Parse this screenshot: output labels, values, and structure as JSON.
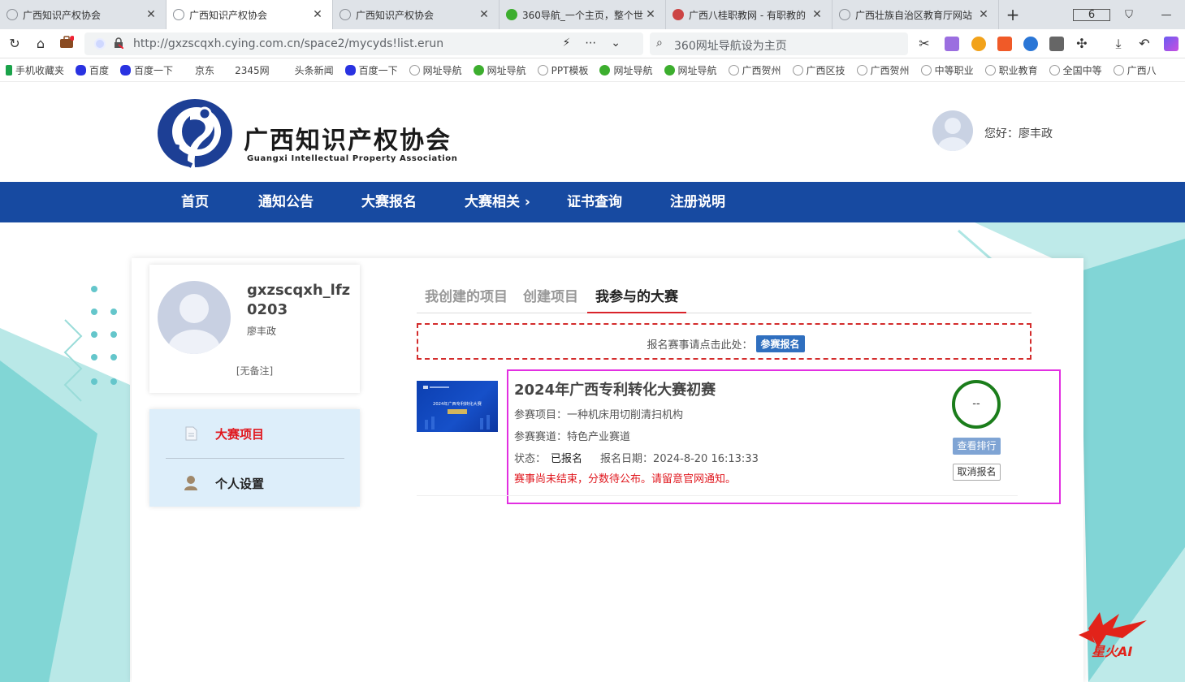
{
  "browser": {
    "tabs": [
      {
        "label": "广西知识产权协会",
        "close": "✕",
        "icon": "globe-icon"
      },
      {
        "label": "广西知识产权协会",
        "close": "✕",
        "icon": "globe-icon"
      },
      {
        "label": "广西知识产权协会",
        "close": "✕",
        "icon": "globe-icon"
      },
      {
        "label": "360导航_一个主页，整个世",
        "close": "✕",
        "icon": "360-icon"
      },
      {
        "label": "广西八桂职教网 - 有职教的",
        "close": "✕",
        "icon": "emblem-icon"
      },
      {
        "label": "广西壮族自治区教育厅网站",
        "close": "✕",
        "icon": "globe-icon"
      }
    ],
    "new_tab": "+",
    "tab_count": "6",
    "url": "http://gxzscqxh.cying.com.cn/space2/mycyds!list.erun",
    "search_placeholder": "360网址导航设为主页",
    "bookmarks": [
      {
        "label": "手机收藏夹",
        "icon": "phone-icon"
      },
      {
        "label": "百度",
        "icon": "baidu-icon"
      },
      {
        "label": "百度一下",
        "icon": "baidu-icon"
      },
      {
        "label": "京东",
        "icon": "none"
      },
      {
        "label": "2345网",
        "icon": "none"
      },
      {
        "label": "头条新闻",
        "icon": "none"
      },
      {
        "label": "百度一下",
        "icon": "baidu-icon"
      },
      {
        "label": "网址导航",
        "icon": "globe-icon"
      },
      {
        "label": "网址导航",
        "icon": "360-icon"
      },
      {
        "label": "PPT模板",
        "icon": "globe-icon"
      },
      {
        "label": "网址导航",
        "icon": "360-icon"
      },
      {
        "label": "网址导航",
        "icon": "360-icon"
      },
      {
        "label": "广西贺州",
        "icon": "globe-icon"
      },
      {
        "label": "广西区技",
        "icon": "globe-icon"
      },
      {
        "label": "广西贺州",
        "icon": "globe-icon"
      },
      {
        "label": "中等职业",
        "icon": "globe-icon"
      },
      {
        "label": "职业教育",
        "icon": "globe-icon"
      },
      {
        "label": "全国中等",
        "icon": "globe-icon"
      },
      {
        "label": "广西八",
        "icon": "globe-icon"
      }
    ]
  },
  "site": {
    "logo_cn": "广西知识产权协会",
    "logo_en": "Guangxi Intellectual Property Association",
    "greeting": "您好：廖丰政",
    "nav": [
      "首页",
      "通知公告",
      "大赛报名",
      "大赛相关 ›",
      "证书查询",
      "注册说明"
    ]
  },
  "profile": {
    "username": "gxzscqxh_lfz0203",
    "realname": "廖丰政",
    "remark": "[无备注]"
  },
  "side_menu": {
    "items": [
      {
        "label": "大赛项目",
        "active": true
      },
      {
        "label": "个人设置",
        "active": false
      }
    ]
  },
  "panel": {
    "tabs": [
      "我创建的项目",
      "创建项目",
      "我参与的大赛"
    ],
    "active_tab": 2,
    "signup_prompt": "报名赛事请点击此处：",
    "signup_button": "参赛报名"
  },
  "contest": {
    "title": "2024年广西专利转化大赛初赛",
    "project_label": "参赛项目：",
    "project": "一种机床用切削清扫机构",
    "track_label": "参赛赛道：",
    "track": "特色产业赛道",
    "status_label": "状态：",
    "status": "已报名",
    "date_label": "报名日期：",
    "date": "2024-8-20 16:13:33",
    "warning": "赛事尚未结束，分数待公布。请留意官网通知。",
    "score": "--",
    "rank_button": "查看排行",
    "cancel_button": "取消报名",
    "thumb_text": "2024年广西专利转化大赛"
  },
  "colors": {
    "nav_bg": "#174aa1",
    "accent_red": "#d9232a",
    "highlight_box": "#e22fe1",
    "score_ring": "#1b7d1b",
    "side_menu_bg": "#ddeefa"
  },
  "watermark": "星火AI"
}
